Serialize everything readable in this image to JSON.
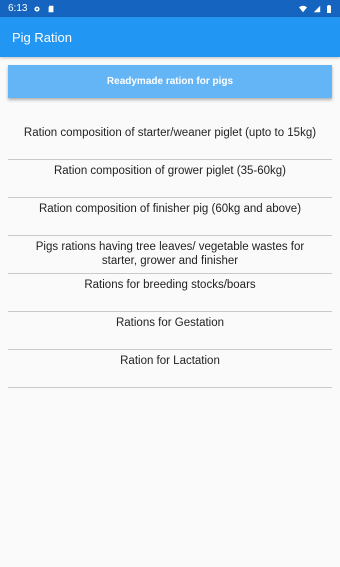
{
  "status": {
    "time": "6:13"
  },
  "app": {
    "title": "Pig Ration"
  },
  "primary_button": {
    "label": "Readymade ration for pigs"
  },
  "items": [
    {
      "label": "Ration composition of starter/weaner piglet (upto to 15kg)"
    },
    {
      "label": "Ration composition of grower piglet (35-60kg)"
    },
    {
      "label": "Ration composition of finisher pig  (60kg and above)"
    },
    {
      "label": "Pigs rations having tree leaves/ vegetable wastes for starter, grower and finisher"
    },
    {
      "label": "Rations for breeding stocks/boars"
    },
    {
      "label": "Rations for Gestation"
    },
    {
      "label": "Ration for Lactation"
    }
  ],
  "colors": {
    "status_bar": "#1565c0",
    "app_bar": "#2196f3",
    "button": "#64b5f6"
  }
}
